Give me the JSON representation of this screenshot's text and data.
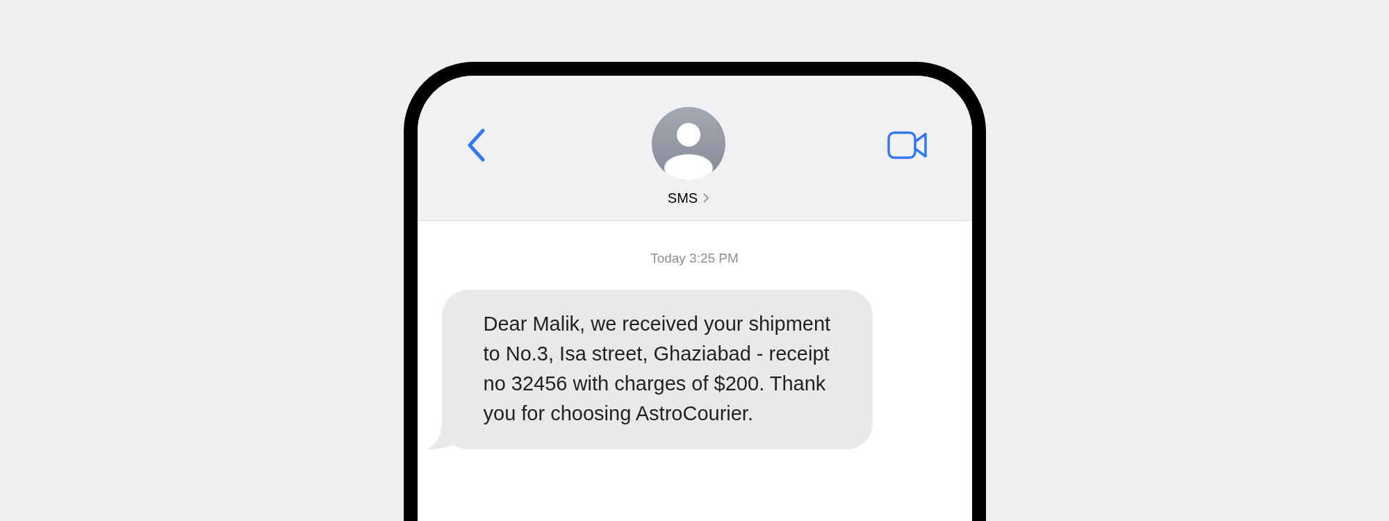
{
  "header": {
    "contact_name": "SMS"
  },
  "timestamp": "Today 3:25 PM",
  "messages": [
    {
      "kind": "incoming",
      "text": "Dear Malik, we received your shipment to No.3, Isa street, Ghaziabad - receipt no 32456 with charges of $200. Thank you for choosing AstroCourier."
    }
  ]
}
